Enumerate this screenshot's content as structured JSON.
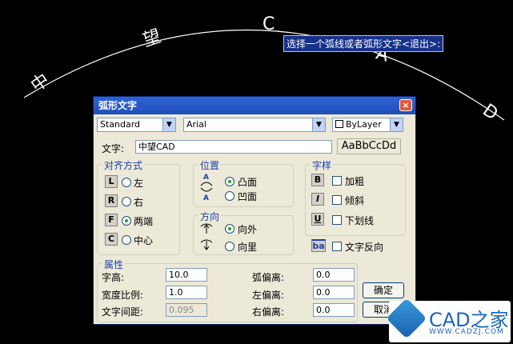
{
  "canvas": {
    "arc_chars": [
      "中",
      "望",
      "C",
      "A",
      "D"
    ],
    "tooltip": "选择一个弧线或者弧形文字<退出>:"
  },
  "dialog": {
    "title": "弧形文字",
    "close_glyph": "×",
    "style_combo": "Standard",
    "font_combo": "Arial",
    "color_combo": "ByLayer",
    "text_label": "文字:",
    "text_value": "中望CAD",
    "preview": "AaBbCcDd",
    "align_group": {
      "title": "对齐方式",
      "items": [
        {
          "key": "L",
          "label": "左",
          "selected": false
        },
        {
          "key": "R",
          "label": "右",
          "selected": false
        },
        {
          "key": "F",
          "label": "两端",
          "selected": true
        },
        {
          "key": "C",
          "label": "中心",
          "selected": false
        }
      ]
    },
    "position_group": {
      "title": "位置",
      "items": [
        {
          "label": "凸面",
          "selected": true
        },
        {
          "label": "凹面",
          "selected": false
        }
      ]
    },
    "direction_group": {
      "title": "方向",
      "items": [
        {
          "label": "向外",
          "selected": true
        },
        {
          "label": "向里",
          "selected": false
        }
      ]
    },
    "style_group": {
      "title": "字样",
      "items": [
        {
          "key": "B",
          "label": "加粗",
          "checked": false
        },
        {
          "key": "I",
          "label": "倾斜",
          "checked": false
        },
        {
          "key": "U",
          "label": "下划线",
          "checked": false
        }
      ]
    },
    "reverse": {
      "key": "ba",
      "label": "文字反向",
      "checked": false
    },
    "props_group": {
      "title": "属性",
      "text_height_label": "字高:",
      "text_height": "10.0",
      "width_ratio_label": "宽度比例:",
      "width_ratio": "1.0",
      "spacing_label": "文字间距:",
      "spacing": "0.095",
      "arc_offset_label": "弧偏离:",
      "arc_offset": "0.0",
      "left_offset_label": "左偏离:",
      "left_offset": "0.0",
      "right_offset_label": "右偏离:",
      "right_offset": "0.0"
    },
    "ok_label": "确定",
    "cancel_label": "取消"
  },
  "watermark": {
    "main": "CAD之家",
    "url": "WWW.CADZJ.COM"
  }
}
